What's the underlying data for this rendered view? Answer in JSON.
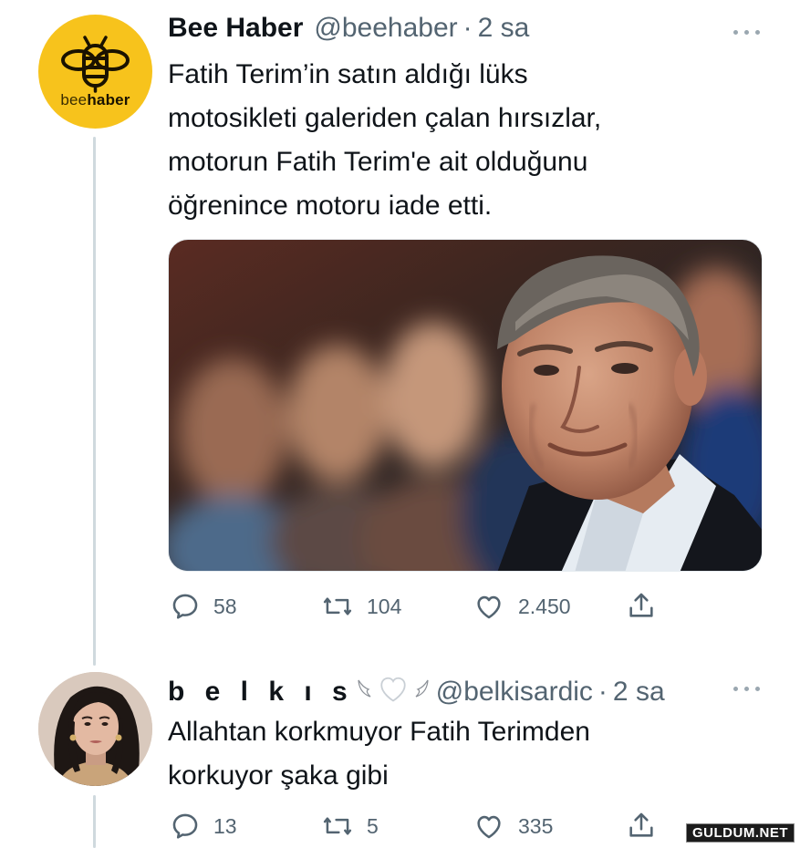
{
  "tweet1": {
    "display_name": "Bee Haber",
    "handle": "@beehaber",
    "separator": "·",
    "time": "2 sa",
    "avatar": {
      "word_light": "bee",
      "word_bold": "haber",
      "bg_color": "#f7c31c"
    },
    "text_lines": [
      "Fatih Terim’in satın aldığı lüks",
      "motosikleti galeriden çalan hırsızlar,",
      "motorun Fatih Terim'e ait olduğunu",
      "öğrenince motoru iade etti."
    ],
    "media": {
      "kind": "photo"
    },
    "replies": "58",
    "retweets": "104",
    "likes": "2.450"
  },
  "tweet2": {
    "display_name": "b e l k ı s",
    "handle": "@belkisardic",
    "separator": "·",
    "time": "2 sa",
    "emoji_icons": [
      "wing-left-icon",
      "white-heart-icon",
      "wing-right-icon"
    ],
    "text_lines": [
      "Allahtan korkmuyor Fatih Terimden",
      "korkuyor şaka gibi"
    ],
    "replies": "13",
    "retweets": "5",
    "likes": "335"
  },
  "watermark": "GULDUM.NET",
  "colors": {
    "text": "#0f1419",
    "secondary": "#536471",
    "thread_line": "#cfd9de"
  }
}
